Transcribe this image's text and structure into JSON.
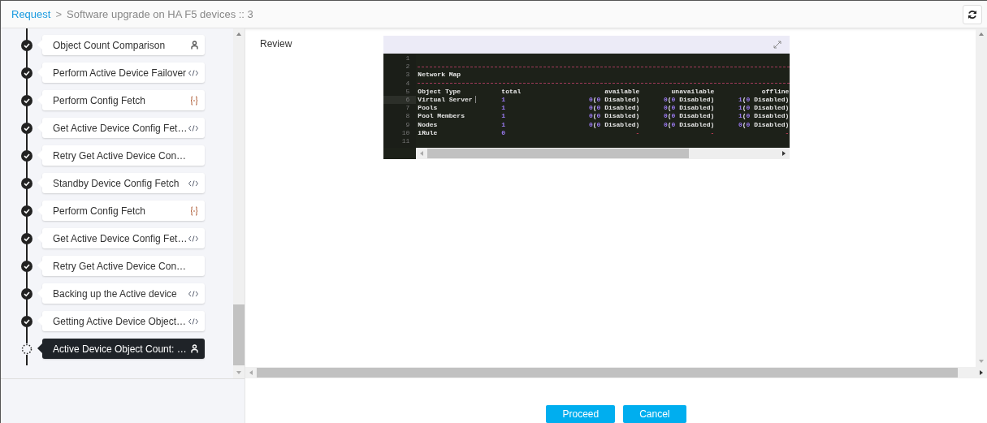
{
  "breadcrumb": {
    "link": "Request",
    "separator": ">",
    "current": "Software upgrade on HA F5 devices :: 3"
  },
  "steps": [
    {
      "label": "Object Count Comparison",
      "completed": true,
      "kind": "manual",
      "selected": false
    },
    {
      "label": "Perform Active Device Failover",
      "completed": true,
      "kind": "script",
      "selected": false
    },
    {
      "label": "Perform Config Fetch",
      "completed": true,
      "kind": "json",
      "selected": false
    },
    {
      "label": "Get Active Device Config Fet…",
      "completed": true,
      "kind": "script",
      "selected": false
    },
    {
      "label": "Retry Get Active Device Con…",
      "completed": true,
      "kind": "plain",
      "selected": false
    },
    {
      "label": "Standby Device Config Fetch",
      "completed": true,
      "kind": "script",
      "selected": false
    },
    {
      "label": "Perform Config Fetch",
      "completed": true,
      "kind": "json",
      "selected": false
    },
    {
      "label": "Get Active Device Config Fet…",
      "completed": true,
      "kind": "script",
      "selected": false
    },
    {
      "label": "Retry Get Active Device Con…",
      "completed": true,
      "kind": "plain",
      "selected": false
    },
    {
      "label": "Backing up the Active device",
      "completed": true,
      "kind": "script",
      "selected": false
    },
    {
      "label": "Getting Active Device Object…",
      "completed": true,
      "kind": "script",
      "selected": false
    },
    {
      "label": "Active Device Object Count: …",
      "completed": false,
      "kind": "manual",
      "selected": true
    }
  ],
  "review": {
    "label": "Review",
    "editor": {
      "lines": [
        {
          "number": "1",
          "kind": "blank",
          "current": false
        },
        {
          "number": "2",
          "kind": "rule",
          "current": false
        },
        {
          "number": "3",
          "kind": "title",
          "current": false,
          "text": "Network Map"
        },
        {
          "number": "4",
          "kind": "rule",
          "current": false
        },
        {
          "number": "5",
          "kind": "header",
          "current": false,
          "cells": [
            "Object Type",
            "total",
            "available",
            "unavailable",
            "offline"
          ]
        },
        {
          "number": "6",
          "kind": "row",
          "current": true,
          "name": "Virtual Server",
          "total": "1",
          "cells": [
            [
              {
                "t": "0",
                "kind": "number"
              },
              {
                "t": "(",
                "kind": "plain"
              },
              {
                "t": "0",
                "kind": "number"
              },
              {
                "t": " Disabled)",
                "kind": "plain"
              }
            ],
            [
              {
                "t": "0",
                "kind": "number"
              },
              {
                "t": "(",
                "kind": "plain"
              },
              {
                "t": "0",
                "kind": "number"
              },
              {
                "t": " Disabled)",
                "kind": "plain"
              }
            ],
            [
              {
                "t": "1",
                "kind": "number"
              },
              {
                "t": "(",
                "kind": "plain"
              },
              {
                "t": "0",
                "kind": "number"
              },
              {
                "t": " Disabled)",
                "kind": "plain"
              }
            ]
          ]
        },
        {
          "number": "7",
          "kind": "row",
          "current": false,
          "name": "Pools",
          "total": "1",
          "cells": [
            [
              {
                "t": "0",
                "kind": "number"
              },
              {
                "t": "(",
                "kind": "plain"
              },
              {
                "t": "0",
                "kind": "number"
              },
              {
                "t": " Disabled)",
                "kind": "plain"
              }
            ],
            [
              {
                "t": "0",
                "kind": "number"
              },
              {
                "t": "(",
                "kind": "plain"
              },
              {
                "t": "0",
                "kind": "number"
              },
              {
                "t": " Disabled)",
                "kind": "plain"
              }
            ],
            [
              {
                "t": "1",
                "kind": "number"
              },
              {
                "t": "(",
                "kind": "plain"
              },
              {
                "t": "0",
                "kind": "number"
              },
              {
                "t": " Disabled)",
                "kind": "plain"
              }
            ]
          ]
        },
        {
          "number": "8",
          "kind": "row",
          "current": false,
          "name": "Pool Members",
          "total": "1",
          "cells": [
            [
              {
                "t": "0",
                "kind": "number"
              },
              {
                "t": "(",
                "kind": "plain"
              },
              {
                "t": "0",
                "kind": "number"
              },
              {
                "t": " Disabled)",
                "kind": "plain"
              }
            ],
            [
              {
                "t": "0",
                "kind": "number"
              },
              {
                "t": "(",
                "kind": "plain"
              },
              {
                "t": "0",
                "kind": "number"
              },
              {
                "t": " Disabled)",
                "kind": "plain"
              }
            ],
            [
              {
                "t": "1",
                "kind": "number"
              },
              {
                "t": "(",
                "kind": "plain"
              },
              {
                "t": "0",
                "kind": "number"
              },
              {
                "t": " Disabled)",
                "kind": "plain"
              }
            ]
          ]
        },
        {
          "number": "9",
          "kind": "row",
          "current": false,
          "name": "Nodes",
          "total": "1",
          "cells": [
            [
              {
                "t": "0",
                "kind": "number"
              },
              {
                "t": "(",
                "kind": "plain"
              },
              {
                "t": "0",
                "kind": "number"
              },
              {
                "t": " Disabled)",
                "kind": "plain"
              }
            ],
            [
              {
                "t": "0",
                "kind": "number"
              },
              {
                "t": "(",
                "kind": "plain"
              },
              {
                "t": "0",
                "kind": "number"
              },
              {
                "t": " Disabled)",
                "kind": "plain"
              }
            ],
            [
              {
                "t": "0",
                "kind": "number"
              },
              {
                "t": "(",
                "kind": "plain"
              },
              {
                "t": "0",
                "kind": "number"
              },
              {
                "t": " Disabled)",
                "kind": "plain"
              }
            ]
          ]
        },
        {
          "number": "10",
          "kind": "row",
          "current": false,
          "name": "iRule",
          "total": "0",
          "cells": [
            [
              {
                "t": "-",
                "kind": "dash"
              }
            ],
            [
              {
                "t": "-",
                "kind": "dash"
              }
            ],
            [
              {
                "t": "-",
                "kind": "dash"
              }
            ]
          ]
        },
        {
          "number": "11",
          "kind": "blank",
          "current": false
        }
      ]
    }
  },
  "buttons": [
    "Proceed",
    "Cancel"
  ]
}
